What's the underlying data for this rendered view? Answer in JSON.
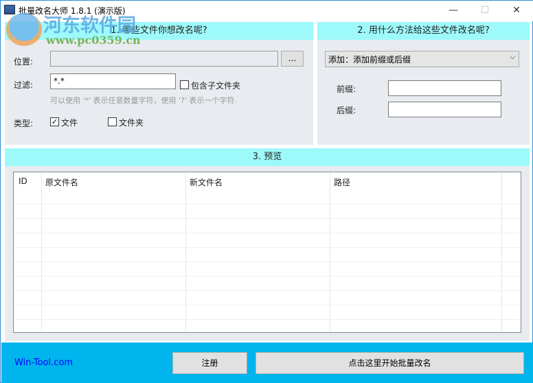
{
  "window": {
    "title": "批量改名大师 1.8.1 (演示版)",
    "minimize": "—",
    "maximize": "☐",
    "close": "✕"
  },
  "watermark": {
    "name": "河东软件园",
    "url": "www.pc0359.cn"
  },
  "section1": {
    "header": "1. 哪些文件你想改名呢?",
    "location_label": "位置:",
    "location_value": "",
    "browse_label": "...",
    "filter_label": "过滤:",
    "filter_value": "*.*",
    "include_subfolders_label": "包含子文件夹",
    "include_subfolders_checked": false,
    "hint": "可以使用 '*' 表示任意数量字符，使用 '?' 表示一个字符.",
    "type_label": "类型:",
    "type_file_label": "文件",
    "type_file_checked": true,
    "type_folder_label": "文件夹",
    "type_folder_checked": false
  },
  "section2": {
    "header": "2. 用什么方法给这些文件改名呢?",
    "method_selected": "添加：添加前缀或后缀",
    "prefix_label": "前缀:",
    "prefix_value": "",
    "suffix_label": "后缀:",
    "suffix_value": ""
  },
  "section3": {
    "header": "3. 预览",
    "columns": [
      "ID",
      "原文件名",
      "新文件名",
      "路径"
    ]
  },
  "footer": {
    "link": "Win-Tool.com",
    "register_label": "注册",
    "start_label": "点击这里开始批量改名"
  },
  "colors": {
    "header_bg": "#9ef9fb",
    "footer_bg": "#00b4ee",
    "link": "#0000ff"
  }
}
